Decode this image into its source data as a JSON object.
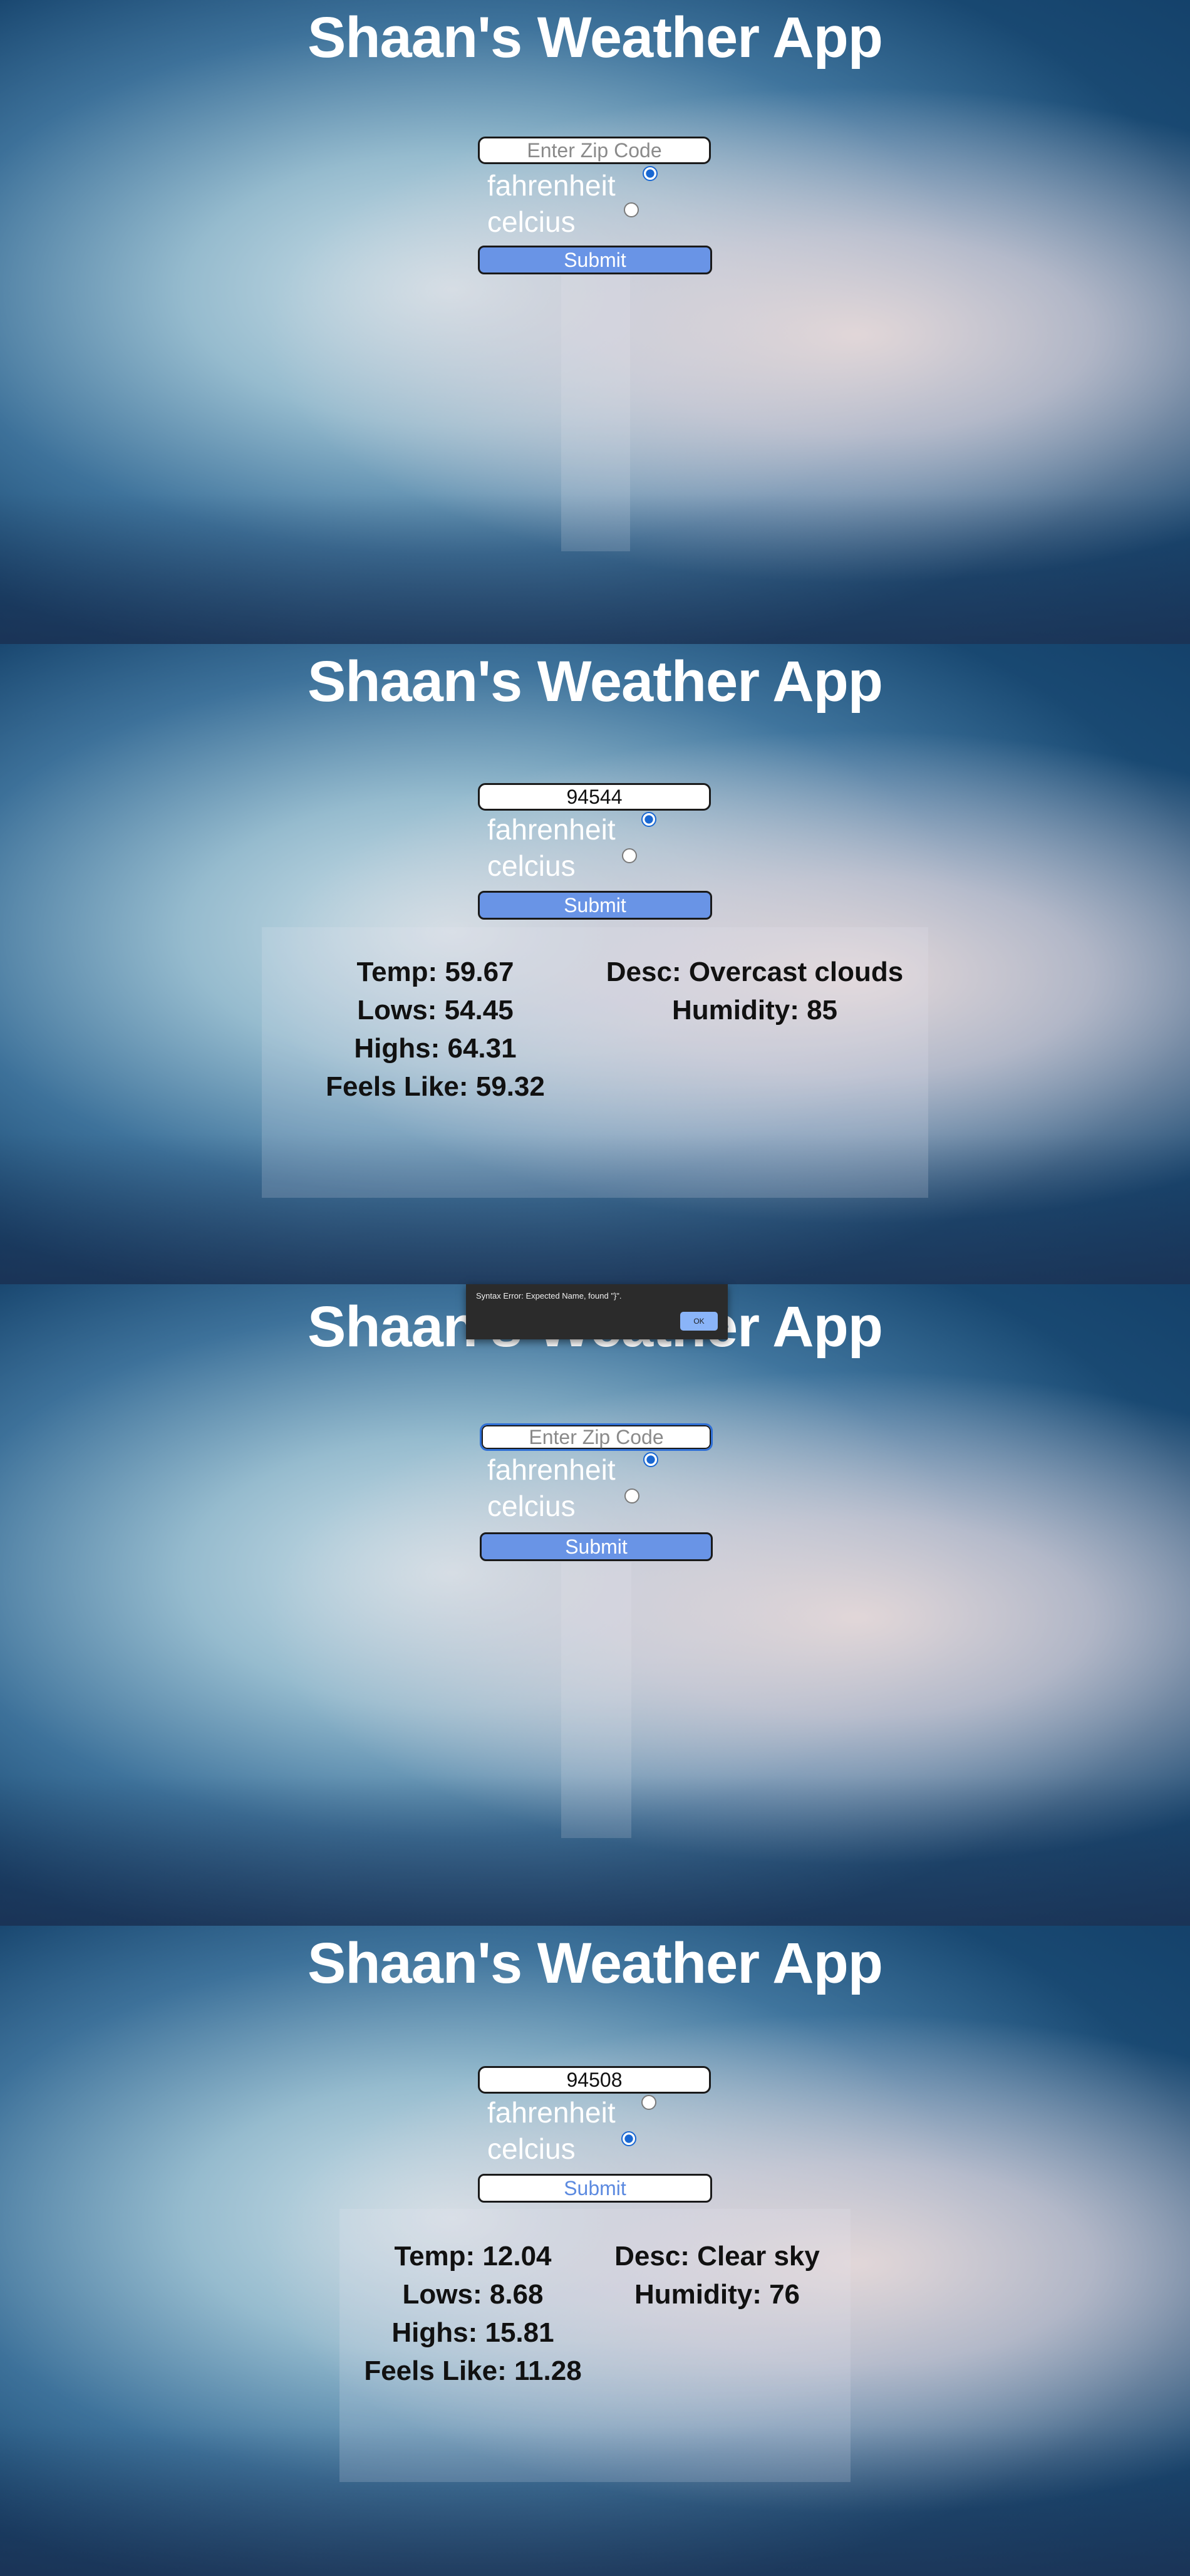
{
  "app_title": "Shaan's Weather App",
  "form": {
    "zip_placeholder": "Enter Zip Code",
    "fahrenheit_label": "fahrenheit",
    "celcius_label": "celcius",
    "submit_label": "Submit"
  },
  "panels": [
    {
      "zip_value": "",
      "selected_unit": "fahrenheit"
    },
    {
      "zip_value": "94544",
      "selected_unit": "fahrenheit",
      "result": {
        "temp": "Temp: 59.67",
        "lows": "Lows: 54.45",
        "highs": "Highs: 64.31",
        "feels_like": "Feels Like: 59.32",
        "desc": "Desc: Overcast clouds",
        "humidity": "Humidity: 85"
      }
    },
    {
      "zip_value": "",
      "selected_unit": "fahrenheit",
      "alert": {
        "message": "Syntax Error: Expected Name, found \"}\".",
        "ok_label": "OK"
      }
    },
    {
      "zip_value": "94508",
      "selected_unit": "celcius",
      "result": {
        "temp": "Temp: 12.04",
        "lows": "Lows: 8.68",
        "highs": "Highs: 15.81",
        "feels_like": "Feels Like: 11.28",
        "desc": "Desc: Clear sky",
        "humidity": "Humidity: 76"
      }
    }
  ],
  "colors": {
    "submit_fill": "#6994e6",
    "radio_checked": "#1967d2",
    "title_text": "#ffffff",
    "result_text": "#111111"
  }
}
